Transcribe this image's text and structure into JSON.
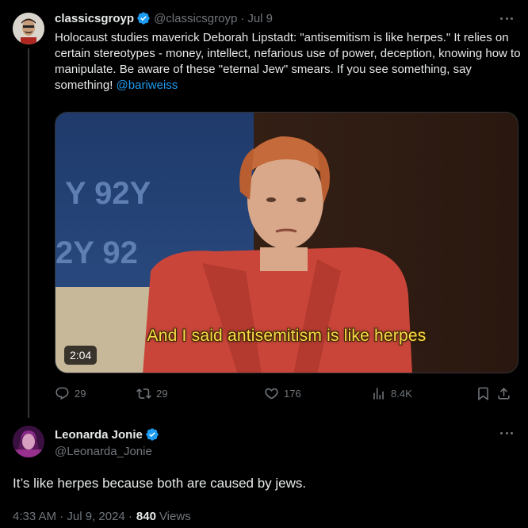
{
  "post": {
    "display_name": "classicsgroyp",
    "handle": "@classicsgroyp",
    "separator": "·",
    "date": "Jul 9",
    "text_before_mention": "Holocaust studies maverick Deborah Lipstadt: \"antisemitism is like herpes.\" It relies on certain stereotypes - money, intellect, nefarious use of power, deception, knowing how to manipulate. Be aware of these \"eternal Jew\" smears. If you see something, say something! ",
    "mention": "@bariweiss",
    "media": {
      "duration": "2:04",
      "caption": "And I said antisemitism is like herpes",
      "backdrop_text": [
        "Y 92Y",
        "2Y 92"
      ]
    },
    "actions": {
      "replies": "29",
      "reposts": "29",
      "likes": "176",
      "views": "8.4K"
    }
  },
  "reply": {
    "display_name": "Leonarda Jonie",
    "handle": "@Leonarda_Jonie",
    "text": "It’s like herpes because both are caused by jews.",
    "timestamp": "4:33 AM · Jul 9, 2024 ·",
    "views_count": "840",
    "views_label": "Views"
  },
  "icons": {
    "verified": "verified-badge-icon",
    "more": "more-dots-icon",
    "reply": "reply-icon",
    "repost": "repost-icon",
    "like": "heart-icon",
    "views": "views-bar-chart-icon",
    "bookmark": "bookmark-icon",
    "share": "share-icon"
  },
  "colors": {
    "background": "#000000",
    "primary_text": "#e7e9ea",
    "secondary_text": "#71767b",
    "accent": "#1d9bf0",
    "caption": "#ffd84a"
  }
}
